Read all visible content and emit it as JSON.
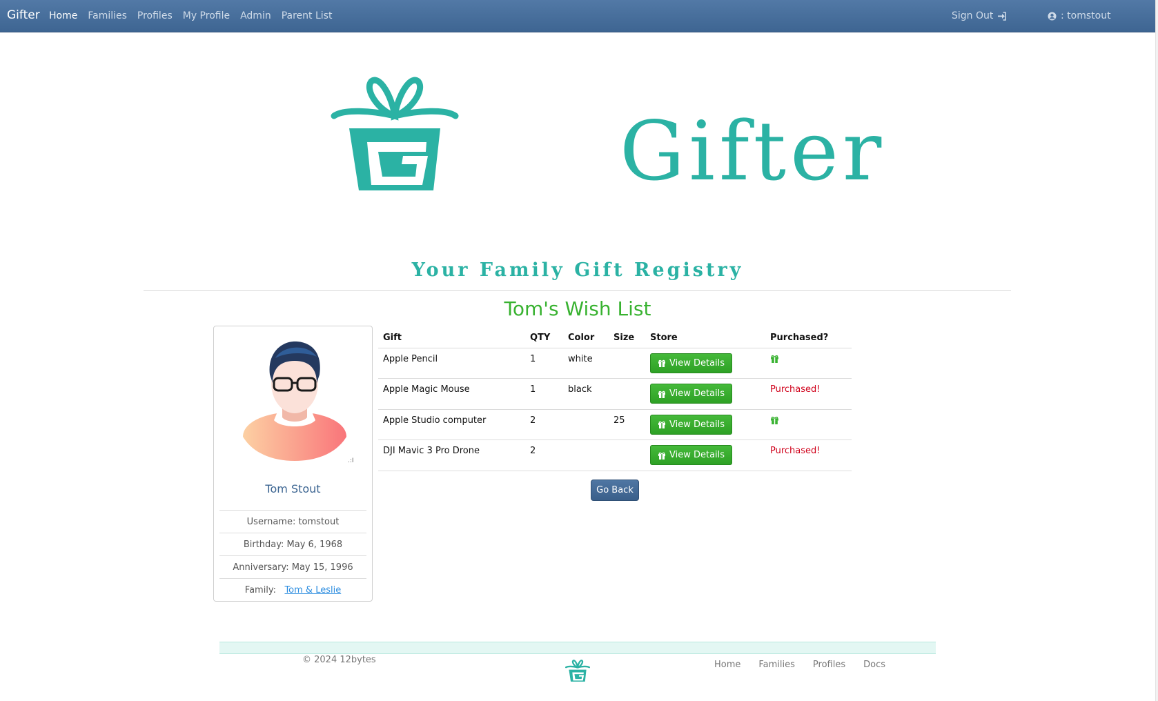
{
  "navbar": {
    "brand": "Gifter",
    "links": [
      "Home",
      "Families",
      "Profiles",
      "My Profile",
      "Admin",
      "Parent List"
    ],
    "active": "Home",
    "sign_out": "Sign Out",
    "user": ": tomstout"
  },
  "hero": {
    "title": "Gifter",
    "tagline": "Your Family Gift Registry",
    "color": "#2bb2a4"
  },
  "wishlist": {
    "title": "Tom's Wish List",
    "columns": [
      "Gift",
      "QTY",
      "Color",
      "Size",
      "Store",
      "Purchased?"
    ],
    "rows": [
      {
        "gift": "Apple Pencil",
        "qty": "1",
        "color": "white",
        "size": "",
        "store": "View Details",
        "purchased": false,
        "purchased_text": ""
      },
      {
        "gift": "Apple Magic Mouse",
        "qty": "1",
        "color": "black",
        "size": "",
        "store": "View Details",
        "purchased": true,
        "purchased_text": "Purchased!"
      },
      {
        "gift": "Apple Studio computer",
        "qty": "2",
        "color": "",
        "size": "25",
        "store": "View Details",
        "purchased": false,
        "purchased_text": ""
      },
      {
        "gift": "DJI Mavic 3 Pro Drone",
        "qty": "2",
        "color": "",
        "size": "",
        "store": "View Details",
        "purchased": true,
        "purchased_text": "Purchased!"
      }
    ],
    "back_button": "Go Back"
  },
  "profile": {
    "name": "Tom Stout",
    "username": "Username: tomstout",
    "birthday": "Birthday: May 6, 1968",
    "anniversary": "Anniversary: May 15, 1996",
    "family_label": "Family:",
    "family_link": "Tom & Leslie"
  },
  "footer": {
    "copyright": "© 2024 12bytes",
    "links": [
      "Home",
      "Families",
      "Profiles",
      "Docs"
    ]
  },
  "colors": {
    "navbar": "#4a709c",
    "accent": "#2bb2a4",
    "success": "#38b230",
    "danger": "#d0021b",
    "link": "#2c8de0"
  }
}
